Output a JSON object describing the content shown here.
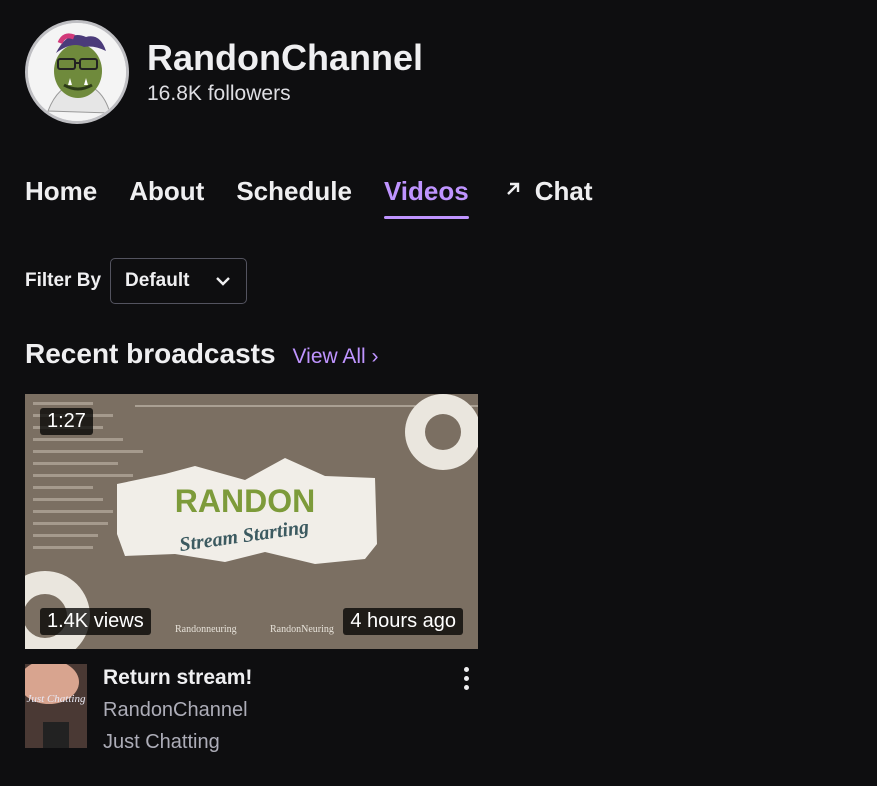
{
  "channel": {
    "name": "RandonChannel",
    "followers": "16.8K followers"
  },
  "tabs": [
    {
      "label": "Home"
    },
    {
      "label": "About"
    },
    {
      "label": "Schedule"
    },
    {
      "label": "Videos",
      "active": true
    },
    {
      "label": "Chat",
      "icon": "external-arrow-icon"
    }
  ],
  "filter": {
    "label": "Filter By",
    "selected": "Default"
  },
  "section": {
    "title": "Recent broadcasts",
    "view_all": "View All"
  },
  "video": {
    "duration": "1:27",
    "views": "1.4K views",
    "age": "4 hours ago",
    "title": "Return stream!",
    "channel": "RandonChannel",
    "game": "Just Chatting",
    "thumbnail_text": {
      "logo": "RANDON",
      "subtitle": "Stream Starting",
      "social_1": "Randonneuring",
      "social_2": "RandonNeuring"
    },
    "game_art_text": "Just Chatting"
  },
  "colors": {
    "accent": "#bf94ff",
    "background": "#0e0e10"
  }
}
